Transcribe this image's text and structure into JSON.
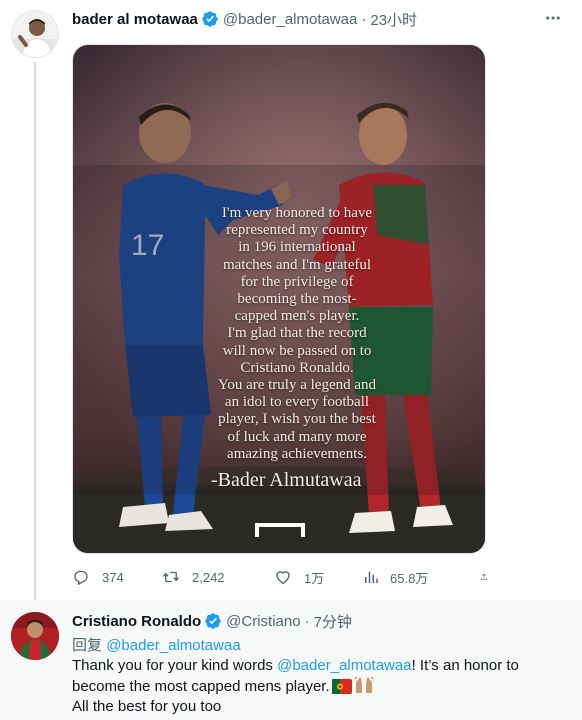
{
  "colors": {
    "accent": "#1d9bf0",
    "text": "#0f1419",
    "muted": "#536471",
    "verified": "#1d9bf0"
  },
  "original_tweet": {
    "author": {
      "display_name": "bader al motawaa",
      "handle": "@bader_almotawaa",
      "verified": true
    },
    "separator": "·",
    "timestamp": "23小时",
    "media": {
      "quote_lines": [
        "I'm very honored to have",
        "represented my country",
        "in 196  international",
        "matches and  I'm grateful",
        "for the privilege of",
        "becoming the most-",
        "capped men's player.",
        "I'm glad that the record",
        "will now be passed on to",
        "Cristiano Ronaldo.",
        "You are truly a legend and",
        "an idol to every football",
        "player, I wish you the best",
        "of luck and many more",
        "amazing achievements."
      ],
      "signature": "-Bader Almutawaa"
    },
    "actions": {
      "replies": "374",
      "retweets": "2,242",
      "likes": "1万",
      "views": "65.8万"
    }
  },
  "reply_tweet": {
    "author": {
      "display_name": "Cristiano Ronaldo",
      "handle": "@Cristiano",
      "verified": true
    },
    "separator": "·",
    "timestamp": "7分钟",
    "replying_prefix": "回复",
    "replying_to": "@bader_almotawaa",
    "text": {
      "line1_before": "Thank you for your kind words ",
      "line1_mention": "@bader_almotawaa",
      "line1_after": "! It’s an honor to",
      "line2": "become the most capped mens player.",
      "line3": "All the best for you too"
    },
    "emoji": [
      "portugal-flag",
      "raising-hands"
    ]
  }
}
